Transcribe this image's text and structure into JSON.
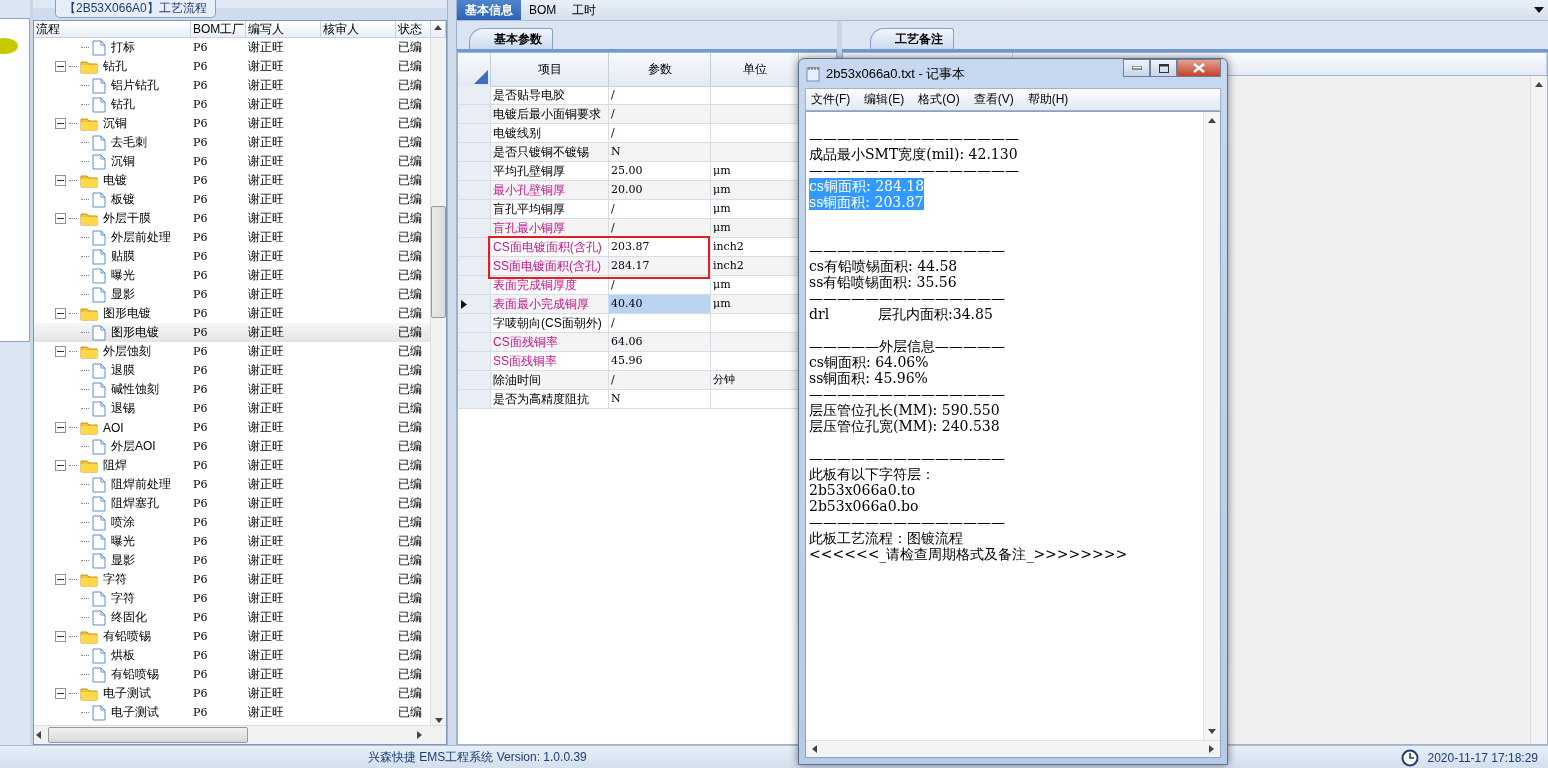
{
  "tree_panel": {
    "title": "【2B53X066A0】工艺流程",
    "columns": [
      "流程",
      "BOM工厂",
      "编写人",
      "核审人",
      "状态"
    ],
    "rows": [
      {
        "name": "打标",
        "kind": "file",
        "factory": "P6",
        "author": "谢正旺",
        "status": "已编",
        "selected": false
      },
      {
        "name": "钻孔",
        "kind": "folder",
        "expanded": true,
        "factory": "P6",
        "author": "谢正旺",
        "status": "已编",
        "selected": false,
        "children": [
          {
            "name": "铝片钻孔",
            "kind": "file",
            "factory": "P6",
            "author": "谢正旺",
            "status": "已编",
            "selected": false
          },
          {
            "name": "钻孔",
            "kind": "file",
            "factory": "P6",
            "author": "谢正旺",
            "status": "已编",
            "selected": false
          }
        ]
      },
      {
        "name": "沉铜",
        "kind": "folder",
        "expanded": true,
        "factory": "P6",
        "author": "谢正旺",
        "status": "已编",
        "selected": false,
        "children": [
          {
            "name": "去毛刺",
            "kind": "file",
            "factory": "P6",
            "author": "谢正旺",
            "status": "已编",
            "selected": false
          },
          {
            "name": "沉铜",
            "kind": "file",
            "factory": "P6",
            "author": "谢正旺",
            "status": "已编",
            "selected": false
          }
        ]
      },
      {
        "name": "电镀",
        "kind": "folder",
        "expanded": true,
        "factory": "P6",
        "author": "谢正旺",
        "status": "已编",
        "selected": false,
        "children": [
          {
            "name": "板镀",
            "kind": "file",
            "factory": "P6",
            "author": "谢正旺",
            "status": "已编",
            "selected": false
          }
        ]
      },
      {
        "name": "外层干膜",
        "kind": "folder",
        "expanded": true,
        "factory": "P6",
        "author": "谢正旺",
        "status": "已编",
        "selected": false,
        "children": [
          {
            "name": "外层前处理",
            "kind": "file",
            "factory": "P6",
            "author": "谢正旺",
            "status": "已编",
            "selected": false
          },
          {
            "name": "贴膜",
            "kind": "file",
            "factory": "P6",
            "author": "谢正旺",
            "status": "已编",
            "selected": false
          },
          {
            "name": "曝光",
            "kind": "file",
            "factory": "P6",
            "author": "谢正旺",
            "status": "已编",
            "selected": false
          },
          {
            "name": "显影",
            "kind": "file",
            "factory": "P6",
            "author": "谢正旺",
            "status": "已编",
            "selected": false
          }
        ]
      },
      {
        "name": "图形电镀",
        "kind": "folder",
        "expanded": true,
        "factory": "P6",
        "author": "谢正旺",
        "status": "已编",
        "selected": false,
        "children": [
          {
            "name": "图形电镀",
            "kind": "file",
            "factory": "P6",
            "author": "谢正旺",
            "status": "已编",
            "selected": true
          }
        ]
      },
      {
        "name": "外层蚀刻",
        "kind": "folder",
        "expanded": true,
        "factory": "P6",
        "author": "谢正旺",
        "status": "已编",
        "selected": false,
        "children": [
          {
            "name": "退膜",
            "kind": "file",
            "factory": "P6",
            "author": "谢正旺",
            "status": "已编",
            "selected": false
          },
          {
            "name": "碱性蚀刻",
            "kind": "file",
            "factory": "P6",
            "author": "谢正旺",
            "status": "已编",
            "selected": false
          },
          {
            "name": "退锡",
            "kind": "file",
            "factory": "P6",
            "author": "谢正旺",
            "status": "已编",
            "selected": false
          }
        ]
      },
      {
        "name": "AOI",
        "kind": "folder",
        "expanded": true,
        "factory": "P6",
        "author": "谢正旺",
        "status": "已编",
        "selected": false,
        "children": [
          {
            "name": "外层AOI",
            "kind": "file",
            "factory": "P6",
            "author": "谢正旺",
            "status": "已编",
            "selected": false
          }
        ]
      },
      {
        "name": "阻焊",
        "kind": "folder",
        "expanded": true,
        "factory": "P6",
        "author": "谢正旺",
        "status": "已编",
        "selected": false,
        "children": [
          {
            "name": "阻焊前处理",
            "kind": "file",
            "factory": "P6",
            "author": "谢正旺",
            "status": "已编",
            "selected": false
          },
          {
            "name": "阻焊塞孔",
            "kind": "file",
            "factory": "P6",
            "author": "谢正旺",
            "status": "已编",
            "selected": false
          },
          {
            "name": "喷涂",
            "kind": "file",
            "factory": "P6",
            "author": "谢正旺",
            "status": "已编",
            "selected": false
          },
          {
            "name": "曝光",
            "kind": "file",
            "factory": "P6",
            "author": "谢正旺",
            "status": "已编",
            "selected": false
          },
          {
            "name": "显影",
            "kind": "file",
            "factory": "P6",
            "author": "谢正旺",
            "status": "已编",
            "selected": false
          }
        ]
      },
      {
        "name": "字符",
        "kind": "folder",
        "expanded": true,
        "factory": "P6",
        "author": "谢正旺",
        "status": "已编",
        "selected": false,
        "children": [
          {
            "name": "字符",
            "kind": "file",
            "factory": "P6",
            "author": "谢正旺",
            "status": "已编",
            "selected": false
          },
          {
            "name": "终固化",
            "kind": "file",
            "factory": "P6",
            "author": "谢正旺",
            "status": "已编",
            "selected": false
          }
        ]
      },
      {
        "name": "有铅喷锡",
        "kind": "folder",
        "expanded": true,
        "factory": "P6",
        "author": "谢正旺",
        "status": "已编",
        "selected": false,
        "children": [
          {
            "name": "烘板",
            "kind": "file",
            "factory": "P6",
            "author": "谢正旺",
            "status": "已编",
            "selected": false
          },
          {
            "name": "有铅喷锡",
            "kind": "file",
            "factory": "P6",
            "author": "谢正旺",
            "status": "已编",
            "selected": false
          }
        ]
      },
      {
        "name": "电子测试",
        "kind": "folder",
        "expanded": true,
        "factory": "P6",
        "author": "谢正旺",
        "status": "已编",
        "selected": false,
        "children": [
          {
            "name": "电子测试",
            "kind": "file",
            "factory": "P6",
            "author": "谢正旺",
            "status": "已编",
            "selected": false
          }
        ]
      }
    ]
  },
  "main_tabs": [
    {
      "label": "基本信息",
      "selected": true
    },
    {
      "label": "BOM",
      "selected": false
    },
    {
      "label": "工时",
      "selected": false
    }
  ],
  "params_panel": {
    "tab": "基本参数",
    "columns": [
      "项目",
      "参数",
      "单位"
    ],
    "rows": [
      {
        "item": "是否贴导电胶",
        "value": "/",
        "kind": "plain",
        "selected": false,
        "highlighted": false
      },
      {
        "item": "电镀后最小面铜要求",
        "value": "/",
        "kind": "plain",
        "selected": false,
        "highlighted": false
      },
      {
        "item": "电镀线别",
        "value": "/",
        "kind": "plain",
        "selected": false,
        "highlighted": false
      },
      {
        "item": "是否只镀铜不镀锡",
        "value": "N",
        "kind": "plain",
        "selected": false,
        "highlighted": false
      },
      {
        "item": "平均孔壁铜厚",
        "value": "25.00",
        "unit": "μm",
        "kind": "plain",
        "selected": false,
        "highlighted": false
      },
      {
        "item": "最小孔壁铜厚",
        "value": "20.00",
        "unit": "μm",
        "kind": "required",
        "selected": false,
        "highlighted": false
      },
      {
        "item": "盲孔平均铜厚",
        "value": "/",
        "unit": "μm",
        "kind": "plain",
        "selected": false,
        "highlighted": false
      },
      {
        "item": "盲孔最小铜厚",
        "value": "/",
        "unit": "μm",
        "kind": "required",
        "selected": false,
        "highlighted": false
      },
      {
        "item": "CS面电镀面积(含孔)",
        "value": "203.87",
        "unit": "inch2",
        "kind": "required",
        "selected": false,
        "highlighted": true
      },
      {
        "item": "SS面电镀面积(含孔)",
        "value": "284.17",
        "unit": "inch2",
        "kind": "required",
        "selected": false,
        "highlighted": true
      },
      {
        "item": "表面完成铜厚度",
        "value": "/",
        "unit": "μm",
        "kind": "required",
        "selected": false,
        "highlighted": false
      },
      {
        "item": "表面最小完成铜厚",
        "value": "40.40",
        "unit": "μm",
        "kind": "required",
        "selected": true,
        "highlighted": false
      },
      {
        "item": "字唛朝向(CS面朝外)",
        "value": "/",
        "kind": "plain",
        "selected": false,
        "highlighted": false
      },
      {
        "item": "CS面残铜率",
        "value": "64.06",
        "kind": "required",
        "selected": false,
        "highlighted": false
      },
      {
        "item": "SS面残铜率",
        "value": "45.96",
        "kind": "required",
        "selected": false,
        "highlighted": false
      },
      {
        "item": "除油时间",
        "value": "/",
        "unit": "分钟",
        "kind": "plain",
        "selected": false,
        "highlighted": false
      },
      {
        "item": "是否为高精度阻抗",
        "value": "N",
        "kind": "plain",
        "selected": false,
        "highlighted": false
      }
    ]
  },
  "notes_panel": {
    "tab": "工艺备注"
  },
  "notepad": {
    "title": "2b53x066a0.txt - 记事本",
    "menu": [
      "文件(F)",
      "编辑(E)",
      "格式(O)",
      "查看(V)",
      "帮助(H)"
    ],
    "lines": [
      {
        "kind": "text",
        "text": "———————————————",
        "selected": false
      },
      {
        "kind": "text",
        "text": "成品最小SMT宽度(mil): 42.130",
        "selected": false
      },
      {
        "kind": "text",
        "text": "———————————————",
        "selected": false
      },
      {
        "kind": "text",
        "text": "cs铜面积: 284.18",
        "selected": true
      },
      {
        "kind": "text",
        "text": "ss铜面积: 203.87",
        "selected": true
      },
      {
        "kind": "blank"
      },
      {
        "kind": "blank"
      },
      {
        "kind": "text",
        "text": "——————————————",
        "selected": false
      },
      {
        "kind": "text",
        "text": "cs有铅喷锡面积: 44.58",
        "selected": false
      },
      {
        "kind": "text",
        "text": "ss有铅喷锡面积: 35.56",
        "selected": false
      },
      {
        "kind": "text",
        "text": "——————————————",
        "selected": false
      },
      {
        "kind": "text",
        "text": "drl           层孔内面积:34.85",
        "selected": false
      },
      {
        "kind": "blank"
      },
      {
        "kind": "text",
        "text": "—————外层信息—————",
        "selected": false
      },
      {
        "kind": "text",
        "text": "cs铜面积: 64.06%",
        "selected": false
      },
      {
        "kind": "text",
        "text": "ss铜面积: 45.96%",
        "selected": false
      },
      {
        "kind": "text",
        "text": "——————————————",
        "selected": false
      },
      {
        "kind": "text",
        "text": "层压管位孔长(MM): 590.550",
        "selected": false
      },
      {
        "kind": "text",
        "text": "层压管位孔宽(MM): 240.538",
        "selected": false
      },
      {
        "kind": "blank"
      },
      {
        "kind": "text",
        "text": "——————————————",
        "selected": false
      },
      {
        "kind": "text",
        "text": "此板有以下字符层：",
        "selected": false
      },
      {
        "kind": "text",
        "text": "2b53x066a0.to",
        "selected": false
      },
      {
        "kind": "text",
        "text": "2b53x066a0.bo",
        "selected": false
      },
      {
        "kind": "text",
        "text": "——————————————",
        "selected": false
      },
      {
        "kind": "text",
        "text": "此板工艺流程：图镀流程",
        "selected": false
      },
      {
        "kind": "text",
        "text": "<<<<<<_请检查周期格式及备注_>>>>>>>>",
        "selected": false
      }
    ]
  },
  "status_bar": {
    "app": "兴森快捷 EMS工程系统 Version: 1.0.0.39",
    "datetime": "2020-11-17 17:18:29"
  }
}
